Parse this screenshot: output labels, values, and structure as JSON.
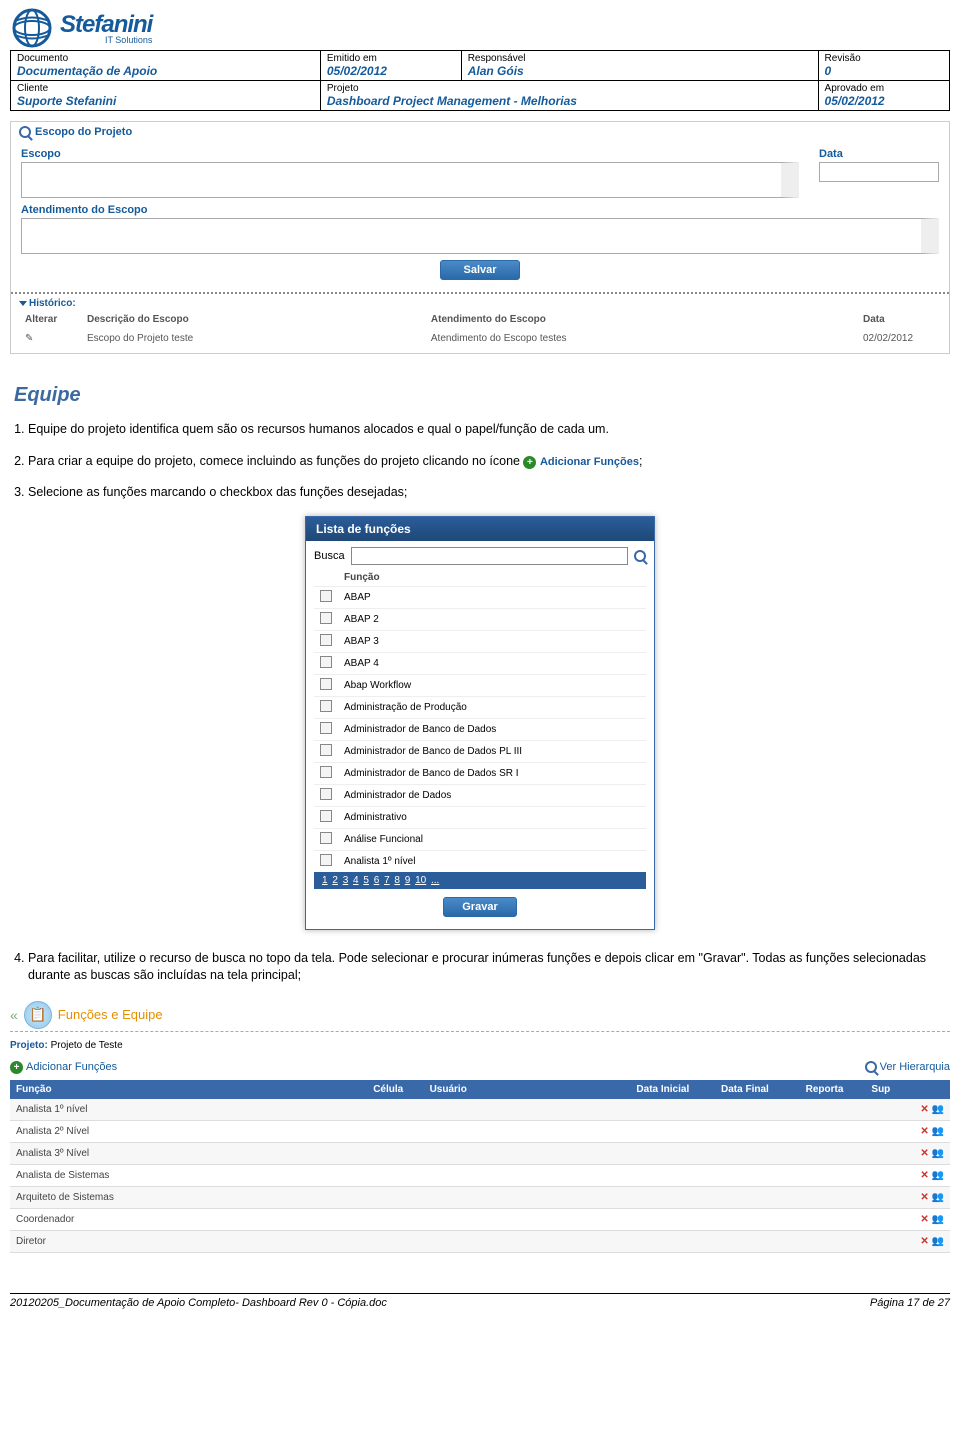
{
  "logo": {
    "name": "Stefanini",
    "sub": "IT Solutions"
  },
  "header": {
    "doc_label": "Documento",
    "doc_value": "Documentação de Apoio",
    "emitido_label": "Emitido em",
    "emitido_value": "05/02/2012",
    "resp_label": "Responsável",
    "resp_value": "Alan Góis",
    "rev_label": "Revisão",
    "rev_value": "0",
    "cliente_label": "Cliente",
    "cliente_value": "Suporte Stefanini",
    "projeto_label": "Projeto",
    "projeto_value": "Dashboard Project Management - Melhorias",
    "aprov_label": "Aprovado em",
    "aprov_value": "05/02/2012"
  },
  "escopo": {
    "panel_title": "Escopo do Projeto",
    "escopo_label": "Escopo",
    "data_label": "Data",
    "atend_label": "Atendimento do Escopo",
    "salvar": "Salvar",
    "historico_label": "Histórico:",
    "th_alterar": "Alterar",
    "th_desc": "Descrição do Escopo",
    "th_atend": "Atendimento do Escopo",
    "th_data": "Data",
    "row_desc": "Escopo do Projeto teste",
    "row_atend": "Atendimento do Escopo testes",
    "row_data": "02/02/2012"
  },
  "section_title": "Equipe",
  "list": {
    "i1": "Equipe do projeto identifica quem são os recursos humanos alocados e qual o papel/função de cada um.",
    "i2a": "Para criar a equipe do projeto, comece incluindo as funções do projeto clicando no ícone ",
    "i2_icon": "Adicionar Funções",
    "i2b": ";",
    "i3": "Selecione as funções marcando o checkbox das funções desejadas;",
    "i4": "Para facilitar, utilize o recurso de busca no topo da tela. Pode selecionar e procurar inúmeras funções e depois clicar em \"Gravar\". Todas as funções selecionadas durante as buscas são incluídas na tela principal;"
  },
  "modal": {
    "title": "Lista de funções",
    "busca": "Busca",
    "th_func": "Função",
    "rows": [
      "ABAP",
      "ABAP 2",
      "ABAP 3",
      "ABAP 4",
      "Abap Workflow",
      "Administração de Produção",
      "Administrador de Banco de Dados",
      "Administrador de Banco de Dados PL III",
      "Administrador de Banco de Dados SR I",
      "Administrador de Dados",
      "Administrativo",
      "Análise Funcional",
      "Analista 1º nível"
    ],
    "pager": [
      "1",
      "2",
      "3",
      "4",
      "5",
      "6",
      "7",
      "8",
      "9",
      "10",
      "..."
    ],
    "gravar": "Gravar"
  },
  "fe": {
    "title": "Funções e Equipe",
    "proj_label": "Projeto:",
    "proj_value": "Projeto de Teste",
    "add": "Adicionar Funções",
    "hier": "Ver Hierarquia",
    "th": {
      "func": "Função",
      "cel": "Célula",
      "usr": "Usuário",
      "di": "Data Inicial",
      "df": "Data Final",
      "rep": "Reporta",
      "sup": "Sup"
    },
    "rows": [
      "Analista 1º nível",
      "Analista 2º Nível",
      "Analista 3º Nível",
      "Analista de Sistemas",
      "Arquiteto de Sistemas",
      "Coordenador",
      "Diretor"
    ]
  },
  "footer": {
    "left": "20120205_Documentação de Apoio Completo- Dashboard Rev 0 - Cópia.doc",
    "right": "Página 17 de 27"
  }
}
